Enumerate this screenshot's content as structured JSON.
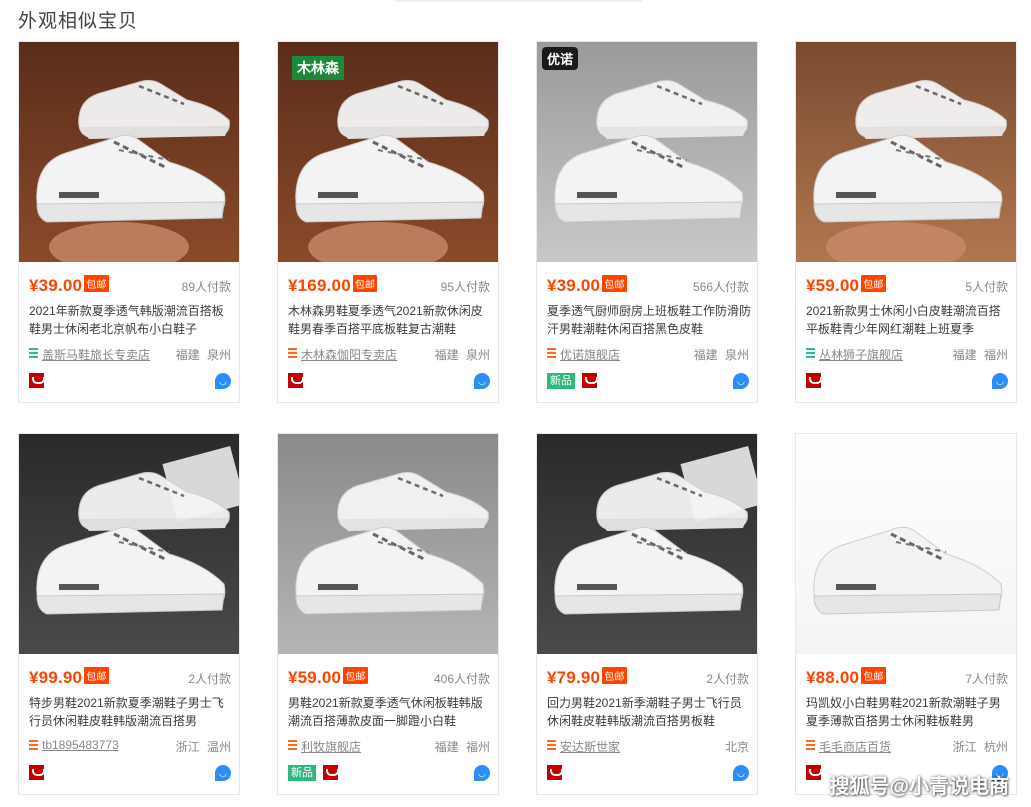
{
  "section_title": "外观相似宝贝",
  "baoyou_label": "包邮",
  "new_label": "新品",
  "products": [
    {
      "price": "¥39.00",
      "paid": "89人付款",
      "title": "2021年新款夏季透气韩版潮流百搭板鞋男士休闲老北京帆布小白鞋子",
      "shop": "盖斯马鞋旅长专卖店",
      "location": "福建 泉州",
      "shop_color": "#2fb8a0",
      "new": false,
      "bg": "wood",
      "logo": ""
    },
    {
      "price": "¥169.00",
      "paid": "95人付款",
      "title": "木林森男鞋夏季透气2021新款休闲皮鞋男春季百搭平底板鞋复古潮鞋",
      "shop": "木林森伽阳专卖店",
      "location": "福建 泉州",
      "shop_color": "#ff6a1a",
      "new": false,
      "bg": "wood",
      "logo": "木林森"
    },
    {
      "price": "¥39.00",
      "paid": "566人付款",
      "title": "夏季透气厨师厨房上班板鞋工作防滑防汗男鞋潮鞋休闲百搭黑色皮鞋",
      "shop": "优诺旗舰店",
      "location": "福建 泉州",
      "shop_color": "#ff6a1a",
      "new": true,
      "bg": "grey",
      "logo": "优诺"
    },
    {
      "price": "¥59.00",
      "paid": "5人付款",
      "title": "2021新款男士休闲小白皮鞋潮流百搭平板鞋青少年网红潮鞋上班夏季",
      "shop": "丛林狮子旗舰店",
      "location": "福建 福州",
      "shop_color": "#2fb8a0",
      "new": false,
      "bg": "wood2",
      "logo": ""
    },
    {
      "price": "¥99.90",
      "paid": "2人付款",
      "title": "特步男鞋2021新款夏季潮鞋子男士飞行员休闲鞋皮鞋韩版潮流百搭男",
      "shop": "tb1895483773",
      "location": "浙江 温州",
      "shop_color": "#ff6a1a",
      "new": false,
      "bg": "dark",
      "logo": ""
    },
    {
      "price": "¥59.00",
      "paid": "406人付款",
      "title": "男鞋2021新款夏季透气休闲板鞋韩版潮流百搭薄款皮面一脚蹬小白鞋",
      "shop": "利牧旗舰店",
      "location": "福建 福州",
      "shop_color": "#ff6a1a",
      "new": true,
      "bg": "floor",
      "logo": ""
    },
    {
      "price": "¥79.90",
      "paid": "2人付款",
      "title": "回力男鞋2021新季潮鞋子男士飞行员休闲鞋皮鞋韩版潮流百搭男板鞋",
      "shop": "安达斯世家",
      "location": "北京",
      "shop_color": "#ff6a1a",
      "new": false,
      "bg": "dark",
      "logo": ""
    },
    {
      "price": "¥88.00",
      "paid": "7人付款",
      "title": "玛凯奴小白鞋男鞋2021新款潮鞋子男夏季薄款百搭男士休闲鞋板鞋男",
      "shop": "毛毛商店百货",
      "location": "浙江 杭州",
      "shop_color": "#ff6a1a",
      "new": false,
      "bg": "white",
      "logo": ""
    }
  ],
  "watermark": "搜狐号@小青说电商",
  "colors": {
    "accent": "#ff4400",
    "new_badge": "#2fb87b",
    "tmall": "#c40000",
    "wangwang": "#2b8ef8"
  }
}
